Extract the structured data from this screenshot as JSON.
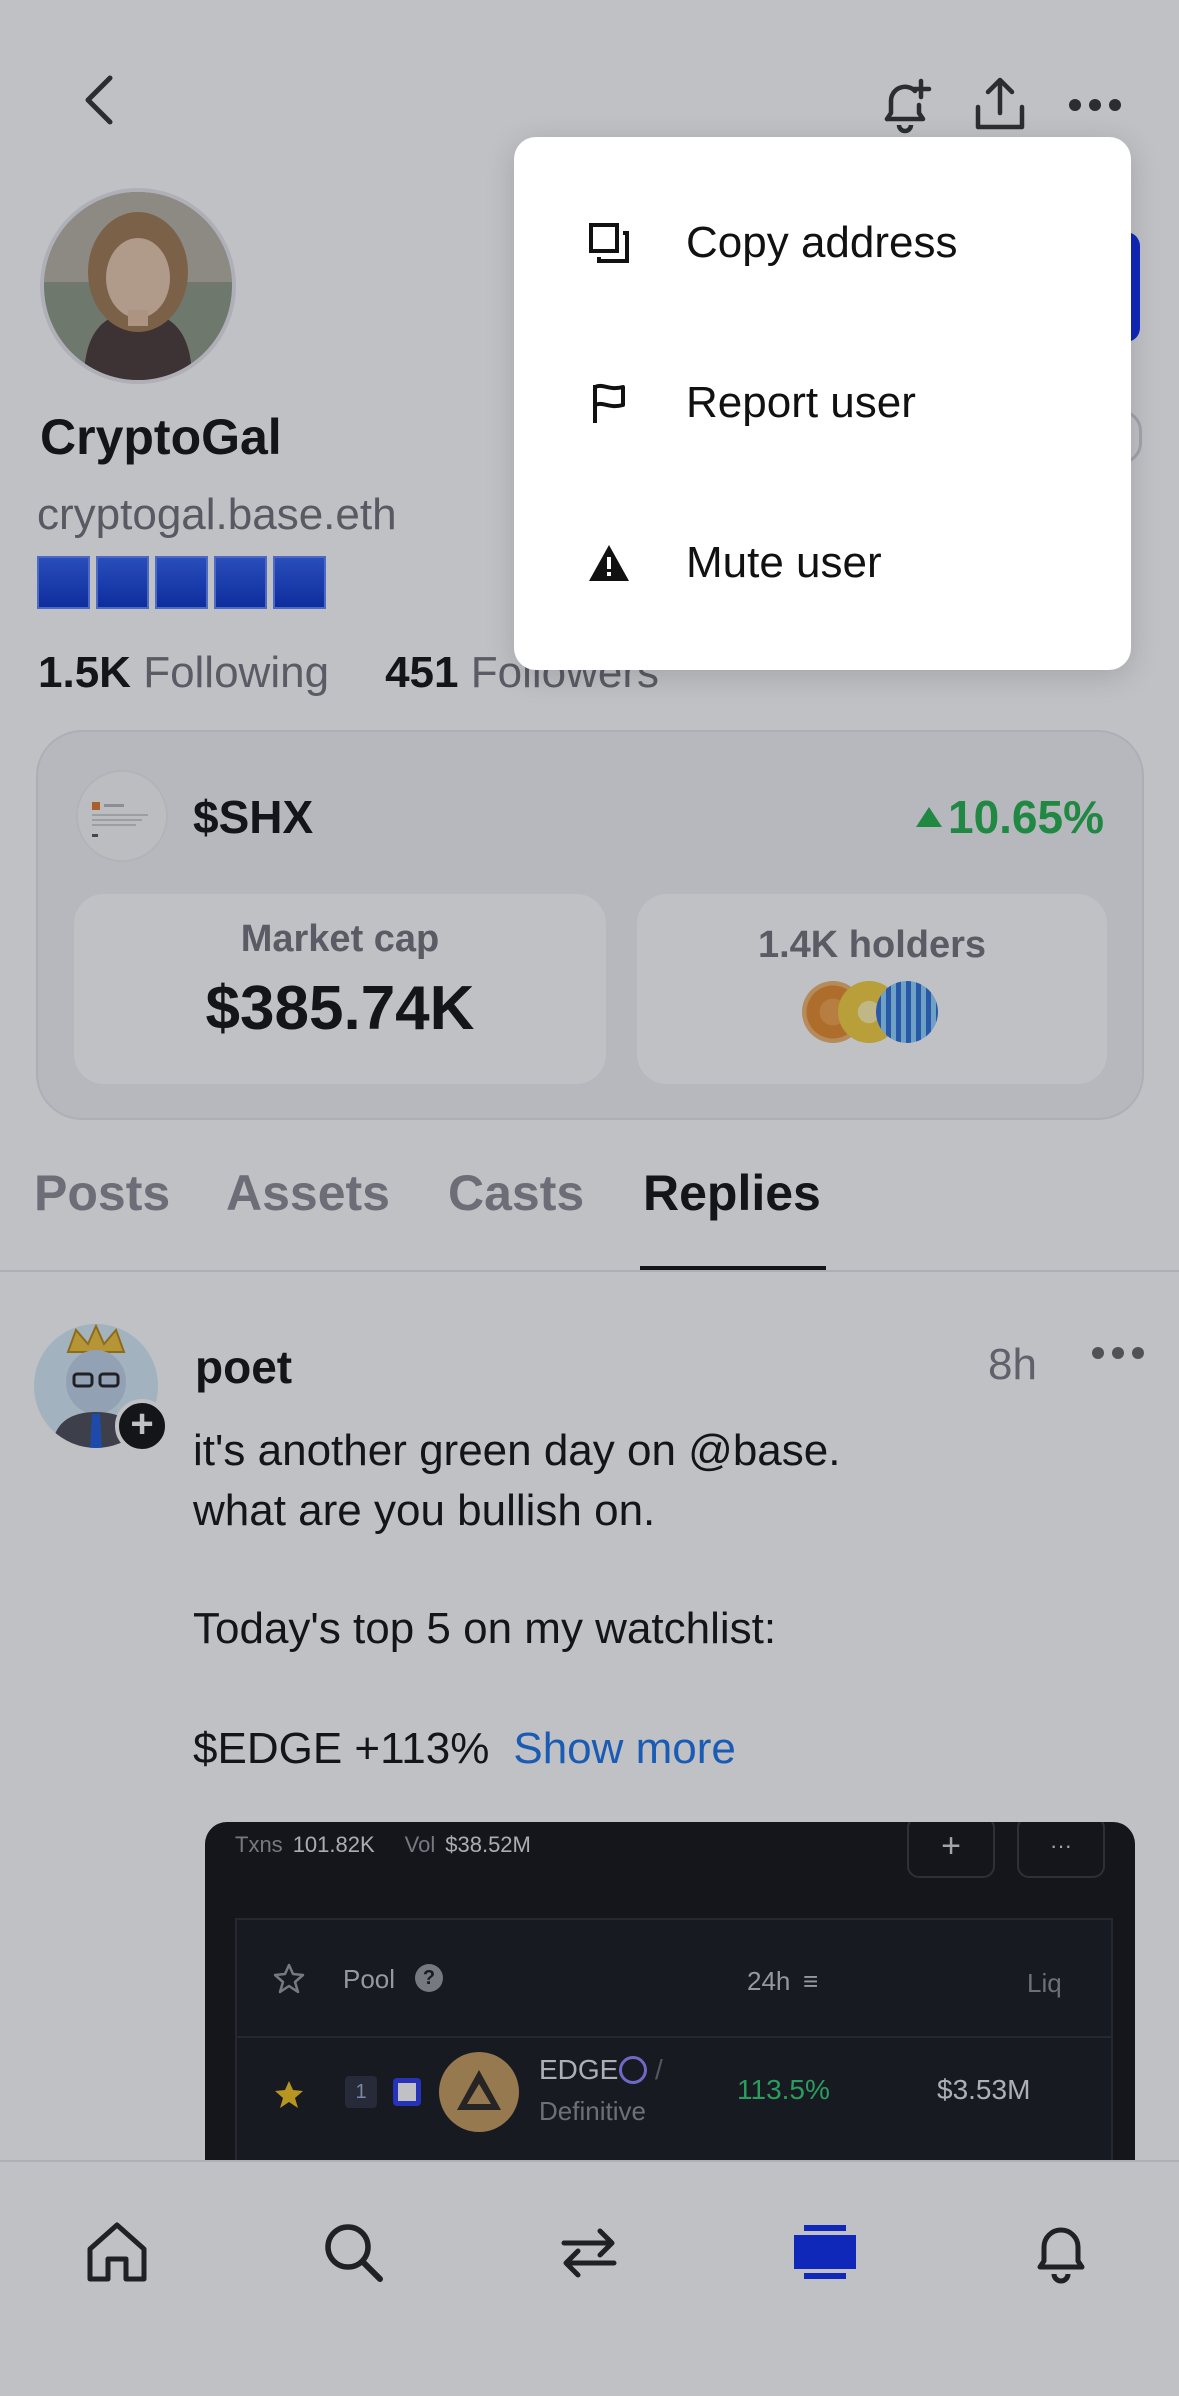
{
  "profile": {
    "display_name": "CryptoGal",
    "handle": "cryptogal.base.eth",
    "following_count": "1.5K",
    "following_label": "Following",
    "followers_count": "451",
    "followers_label": "Followers"
  },
  "token": {
    "ticker": "$SHX",
    "change": "10.65%",
    "market_cap_label": "Market cap",
    "market_cap_value": "$385.74K",
    "holders_label": "1.4K holders"
  },
  "tabs": [
    {
      "label": "Posts"
    },
    {
      "label": "Assets"
    },
    {
      "label": "Casts"
    },
    {
      "label": "Replies"
    }
  ],
  "post": {
    "author": "poet",
    "time": "8h",
    "lines": [
      "it's another green day on @base.",
      "what are you bullish on.",
      "Today's top 5 on my watchlist:",
      "$EDGE +113%"
    ],
    "show_more": "Show more",
    "embed": {
      "txns_label": "Txns",
      "txns_value": "101.82K",
      "vol_label": "Vol",
      "vol_value": "$38.52M",
      "plus": "+",
      "dots": "···",
      "col_pool": "Pool",
      "col_24h": "24h",
      "col_liq": "Liq",
      "row_rank": "1",
      "row_name": "EDGE",
      "row_slash": "/",
      "row_sub": "Definitive",
      "row_change": "113.5%",
      "row_liq": "$3.53M"
    }
  },
  "menu": {
    "items": [
      {
        "label": "Copy address",
        "icon": "copy-icon"
      },
      {
        "label": "Report user",
        "icon": "flag-icon"
      },
      {
        "label": "Mute user",
        "icon": "warning-icon"
      }
    ]
  },
  "nav": {
    "items": [
      "home-icon",
      "search-icon",
      "swap-icon",
      "profile-stack-icon",
      "bell-icon"
    ],
    "active": "profile-stack-icon",
    "active_color": "#0a2cf0"
  },
  "colors": {
    "positive": "#22b14c",
    "link": "#1a73e8",
    "brand_blue": "#0a2cf0"
  }
}
